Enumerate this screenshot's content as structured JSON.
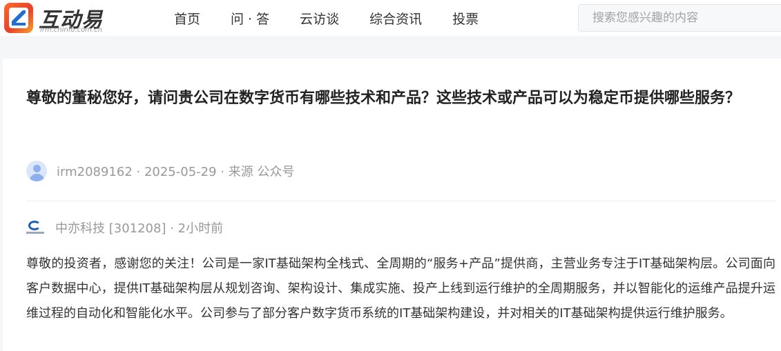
{
  "header": {
    "logo_text": "互动易",
    "logo_sub": "irm.cninfo.com.cn",
    "nav": [
      "首页",
      "问 · 答",
      "云访谈",
      "综合资讯",
      "投票"
    ],
    "search_placeholder": "搜索您感兴趣的内容"
  },
  "question": {
    "title": "尊敬的董秘您好，请问贵公司在数字货币有哪些技术和产品？这些技术或产品可以为稳定币提供哪些服务？",
    "meta": "irm2089162 · 2025-05-29 · 来源 公众号"
  },
  "answer": {
    "company": "中亦科技 [301208] · 2小时前",
    "text": "尊敬的投资者，感谢您的关注！公司是一家IT基础架构全栈式、全周期的“服务+产品”提供商，主营业务专注于IT基础架构层。公司面向客户数据中心，提供IT基础架构层从规划咨询、架构设计、集成实施、投产上线到运行维护的全周期服务，并以智能化的运维产品提升运维过程的自动化和智能化水平。公司参与了部分客户数字货币系统的IT基础架构建设，并对相关的IT基础架构提供运行维护服务。"
  },
  "colors": {
    "accent": "#1f6fd6",
    "logo_orange": "#e8402a",
    "muted": "#999999"
  }
}
